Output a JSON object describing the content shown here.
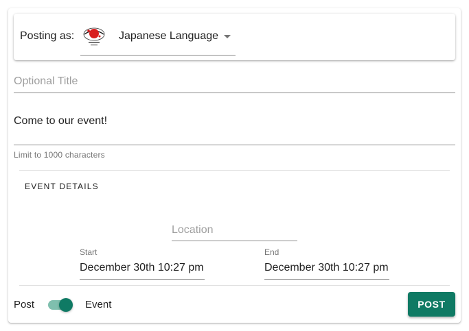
{
  "composer": {
    "posting_as_label": "Posting as:",
    "poster_name": "Japanese Language",
    "avatar_icon": "japanese-club-logo",
    "title_placeholder": "Optional Title",
    "body_text": "Come to our event!",
    "body_hint": "Limit to 1000 characters"
  },
  "event": {
    "heading": "EVENT DETAILS",
    "location_placeholder": "Location",
    "start_label": "Start",
    "start_value": "December 30th 10:27 pm",
    "end_label": "End",
    "end_value": "December 30th 10:27 pm"
  },
  "footer": {
    "post_label": "Post",
    "event_label": "Event",
    "toggle_state": "event",
    "post_button": "POST"
  },
  "colors": {
    "accent": "#0f7a64",
    "accent_light": "#7fbfae"
  }
}
